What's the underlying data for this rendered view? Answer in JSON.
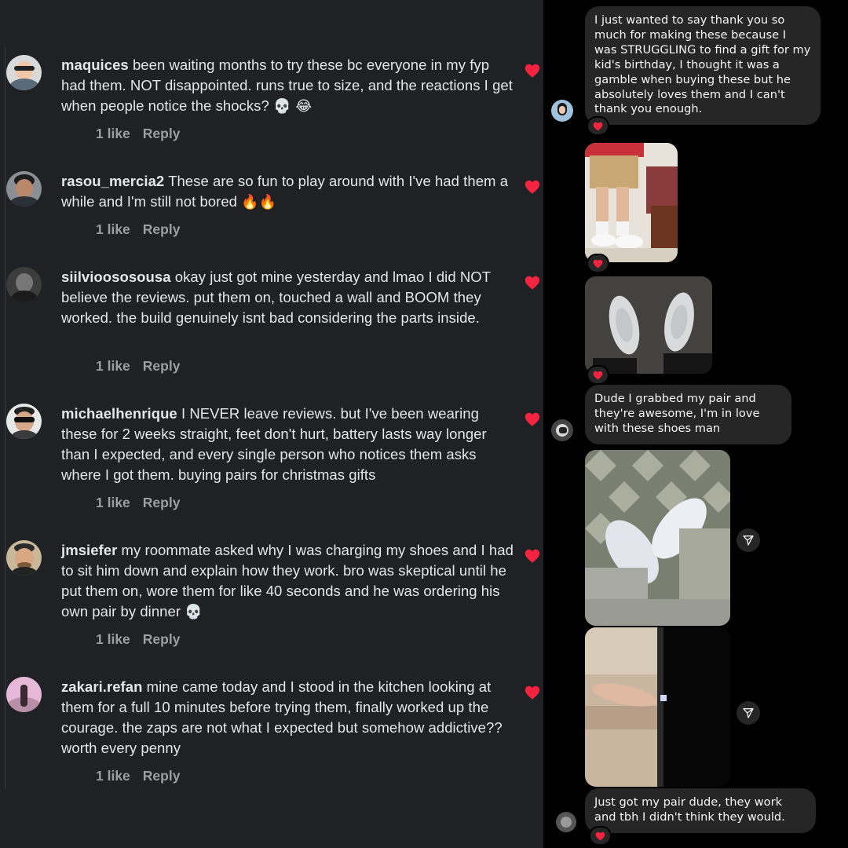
{
  "comments": [
    {
      "username": "maquices",
      "text": " been waiting months to try these bc everyone in my fyp had them. NOT disappointed. runs true to size, and the reactions I get when people notice the shocks? ",
      "emoji": "💀 😂",
      "likes": "1 like",
      "reply": "Reply"
    },
    {
      "username": "rasou_mercia2",
      "text": " These are so fun to play around with I've had them a while and I'm still not bored ",
      "emoji": "🔥🔥",
      "likes": "1 like",
      "reply": "Reply"
    },
    {
      "username": "siilvioososousa",
      "text": " okay just got mine yesterday and lmao I did NOT believe the reviews. put them on, touched a wall and BOOM they worked. the build genuinely isnt bad considering the parts inside.",
      "emoji": "",
      "likes": "1 like",
      "reply": "Reply"
    },
    {
      "username": "michaelhenrique",
      "text": " I NEVER leave reviews. but I've been wearing these for 2 weeks straight, feet don't hurt, battery lasts way longer than I expected, and every single person who notices them asks where I got them. buying pairs for christmas gifts",
      "emoji": "",
      "likes": "1 like",
      "reply": "Reply"
    },
    {
      "username": "jmsiefer",
      "text": " my roommate asked why I was charging my shoes and I had to sit him down and explain how they work. bro was skeptical until he put them on, wore them for like 40 seconds and he was ordering his own pair by dinner ",
      "emoji": "💀",
      "likes": "1 like",
      "reply": "Reply"
    },
    {
      "username": "zakari.refan",
      "text": " mine came today and I stood in the kitchen looking at them for a full 10 minutes before trying them, finally worked up the courage. the zaps are not what I expected but somehow addictive?? worth every penny",
      "emoji": "",
      "likes": "1 like",
      "reply": "Reply"
    }
  ],
  "messages": [
    {
      "text": "I just wanted to say thank you so much for making these because I was STRUGGLING to find a gift for my kid's birthday, I thought it was a gamble when buying these but he absolutely loves them and I can't thank you enough."
    },
    {
      "text": "Dude I grabbed my pair and they're awesome, I'm in love with these shoes man"
    },
    {
      "text": "Just got my pair dude, they work and tbh I didn't think they would."
    }
  ],
  "icons": {
    "like": "heart-icon",
    "reaction": "heart-reaction-icon",
    "share": "share-send-icon"
  },
  "colors": {
    "heart": "#f2243f",
    "left_bg": "#202125",
    "bubble": "#262626"
  }
}
